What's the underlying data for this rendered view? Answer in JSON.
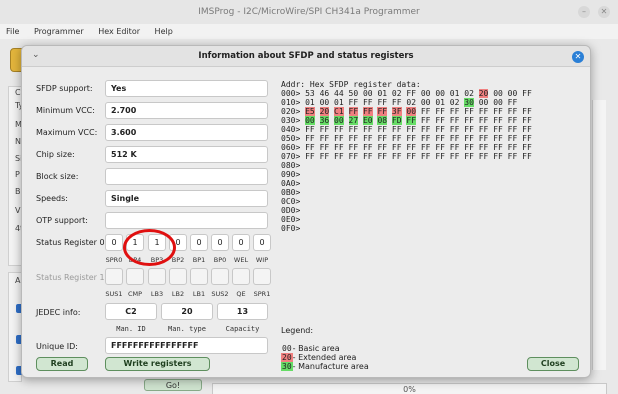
{
  "window": {
    "title": "IMSProg - I2C/MicroWire/SPI CH341a Programmer",
    "menu": [
      "File",
      "Programmer",
      "Hex Editor",
      "Help"
    ]
  },
  "background": {
    "letters": [
      "C",
      "Ty",
      "M",
      "N",
      "Si",
      "P",
      "Bl",
      "V",
      "4t",
      "A"
    ],
    "go_label": "Go!",
    "progress": "0%"
  },
  "dialog": {
    "title": "Information about SFDP and status registers",
    "fields": {
      "sfdp_support": {
        "label": "SFDP support:",
        "value": "Yes"
      },
      "min_vcc": {
        "label": "Minimum VCC:",
        "value": "2.700"
      },
      "max_vcc": {
        "label": "Maximum VCC:",
        "value": "3.600"
      },
      "chip_size": {
        "label": "Chip size:",
        "value": "512 K"
      },
      "block_size": {
        "label": "Block size:",
        "value": ""
      },
      "speeds": {
        "label": "Speeds:",
        "value": "Single"
      },
      "otp_support": {
        "label": "OTP support:",
        "value": ""
      }
    },
    "status_register_0": {
      "label": "Status Register 0",
      "bits": [
        "0",
        "1",
        "1",
        "0",
        "0",
        "0",
        "0",
        "0"
      ],
      "bit_labels": [
        "SPR0",
        "BP4",
        "BP3",
        "BP2",
        "BP1",
        "BP0",
        "WEL",
        "WIP"
      ]
    },
    "status_register_1": {
      "label": "Status Register 1",
      "bits": [
        "",
        "",
        "",
        "",
        "",
        "",
        "",
        ""
      ],
      "bit_labels": [
        "SUS1",
        "CMP",
        "LB3",
        "LB2",
        "LB1",
        "SUS2",
        "QE",
        "SPR1"
      ]
    },
    "jedec": {
      "label": "JEDEC info:",
      "values": [
        "C2",
        "20",
        "13"
      ],
      "captions": [
        "Man. ID",
        "Man. type",
        "Capacity"
      ]
    },
    "unique_id": {
      "label": "Unique ID:",
      "value": "FFFFFFFFFFFFFFFF"
    },
    "buttons": {
      "read": "Read",
      "write": "Write registers",
      "close": "Close"
    },
    "hex": {
      "header": "Addr: Hex SFDP register data:",
      "rows": [
        {
          "addr": "000>",
          "bytes": [
            "53",
            "46",
            "44",
            "50",
            "00",
            "01",
            "02",
            "FF",
            "00",
            "00",
            "01",
            "02",
            "20",
            "00",
            "00",
            "FF"
          ]
        },
        {
          "addr": "010>",
          "bytes": [
            "01",
            "00",
            "01",
            "FF",
            "FF",
            "FF",
            "FF",
            "02",
            "00",
            "01",
            "02",
            "30",
            "00",
            "00",
            "FF",
            ""
          ]
        },
        {
          "addr": "020>",
          "bytes": [
            "E5",
            "20",
            "C1",
            "FF",
            "FF",
            "FF",
            "3F",
            "00",
            "FF",
            "FF",
            "FF",
            "FF",
            "FF",
            "FF",
            "FF",
            "FF"
          ]
        },
        {
          "addr": "030>",
          "bytes": [
            "00",
            "36",
            "00",
            "27",
            "E0",
            "08",
            "FD",
            "FF",
            "FF",
            "FF",
            "FF",
            "FF",
            "FF",
            "FF",
            "FF",
            "FF"
          ]
        },
        {
          "addr": "040>",
          "bytes": [
            "FF",
            "FF",
            "FF",
            "FF",
            "FF",
            "FF",
            "FF",
            "FF",
            "FF",
            "FF",
            "FF",
            "FF",
            "FF",
            "FF",
            "FF",
            "FF"
          ]
        },
        {
          "addr": "050>",
          "bytes": [
            "FF",
            "FF",
            "FF",
            "FF",
            "FF",
            "FF",
            "FF",
            "FF",
            "FF",
            "FF",
            "FF",
            "FF",
            "FF",
            "FF",
            "FF",
            "FF"
          ]
        },
        {
          "addr": "060>",
          "bytes": [
            "FF",
            "FF",
            "FF",
            "FF",
            "FF",
            "FF",
            "FF",
            "FF",
            "FF",
            "FF",
            "FF",
            "FF",
            "FF",
            "FF",
            "FF",
            "FF"
          ]
        },
        {
          "addr": "070>",
          "bytes": [
            "FF",
            "FF",
            "FF",
            "FF",
            "FF",
            "FF",
            "FF",
            "FF",
            "FF",
            "FF",
            "FF",
            "FF",
            "FF",
            "FF",
            "FF",
            "FF"
          ]
        },
        {
          "addr": "080>",
          "bytes": []
        },
        {
          "addr": "090>",
          "bytes": []
        },
        {
          "addr": "0A0>",
          "bytes": []
        },
        {
          "addr": "0B0>",
          "bytes": []
        },
        {
          "addr": "0C0>",
          "bytes": []
        },
        {
          "addr": "0D0>",
          "bytes": []
        },
        {
          "addr": "0E0>",
          "bytes": []
        },
        {
          "addr": "0F0>",
          "bytes": []
        }
      ],
      "highlights": {
        "extended": [
          [
            0,
            12
          ],
          [
            2,
            0
          ],
          [
            2,
            1
          ],
          [
            2,
            2
          ],
          [
            2,
            3
          ],
          [
            2,
            4
          ],
          [
            2,
            5
          ],
          [
            2,
            6
          ],
          [
            2,
            7
          ]
        ],
        "manufacture": [
          [
            1,
            11
          ],
          [
            3,
            0
          ],
          [
            3,
            1
          ],
          [
            3,
            2
          ],
          [
            3,
            3
          ],
          [
            3,
            4
          ],
          [
            3,
            5
          ],
          [
            3,
            6
          ],
          [
            3,
            7
          ]
        ]
      }
    },
    "legend": {
      "title": "Legend:",
      "items": [
        {
          "code": "00",
          "text": "- Basic area",
          "kind": "basic"
        },
        {
          "code": "20",
          "text": "- Extended area",
          "kind": "extended"
        },
        {
          "code": "30",
          "text": "- Manufacture area",
          "kind": "manufacture"
        }
      ]
    },
    "colors": {
      "extended": "#f08080",
      "manufacture": "#66dd66",
      "accent": "#2a7fd6",
      "highlight_circle": "#e01010"
    }
  }
}
